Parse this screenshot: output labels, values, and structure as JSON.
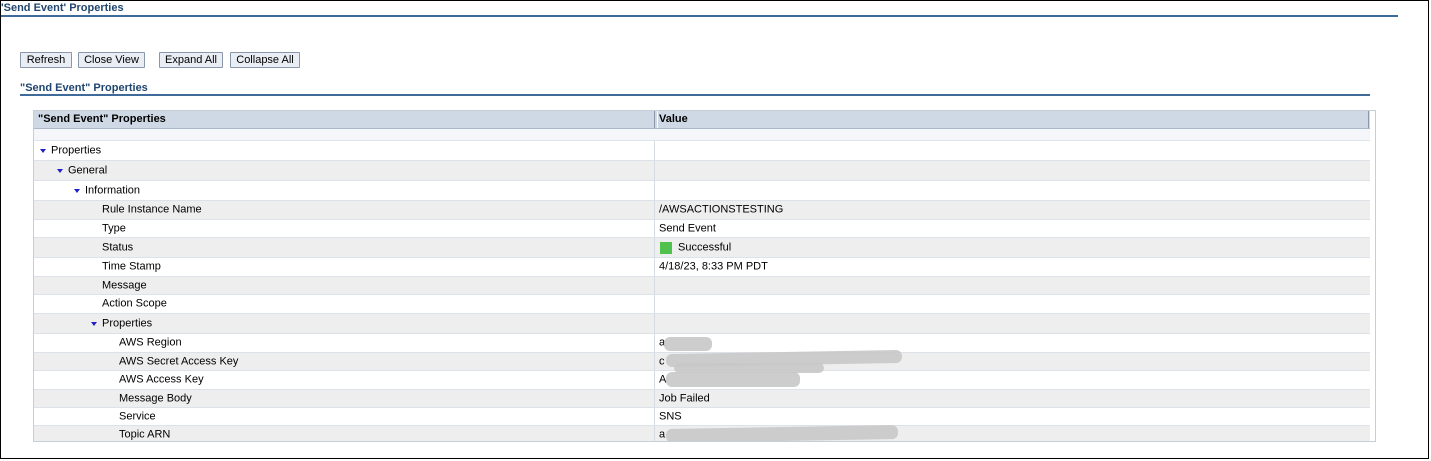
{
  "header": {
    "title": "'Send Event' Properties"
  },
  "toolbar": {
    "refresh_label": "Refresh",
    "close_view_label": "Close View",
    "expand_all_label": "Expand All",
    "collapse_all_label": "Collapse All"
  },
  "section": {
    "title": "\"Send Event\" Properties"
  },
  "table": {
    "columns": [
      "\"Send Event\" Properties",
      "Value"
    ],
    "rows": [
      {
        "label": "Properties",
        "value": ""
      },
      {
        "label": "General",
        "value": ""
      },
      {
        "label": "Information",
        "value": ""
      },
      {
        "label": "Rule Instance Name",
        "value": "/AWSACTIONSTESTING"
      },
      {
        "label": "Type",
        "value": "Send Event"
      },
      {
        "label": "Status",
        "value": "Successful"
      },
      {
        "label": "Time Stamp",
        "value": "4/18/23, 8:33 PM PDT"
      },
      {
        "label": "Message",
        "value": ""
      },
      {
        "label": "Action Scope",
        "value": ""
      },
      {
        "label": "Properties",
        "value": ""
      },
      {
        "label": "AWS Region",
        "value": "a"
      },
      {
        "label": "AWS Secret Access Key",
        "value": "c"
      },
      {
        "label": "AWS Access Key",
        "value": "A"
      },
      {
        "label": "Message Body",
        "value": "Job Failed"
      },
      {
        "label": "Service",
        "value": "SNS"
      },
      {
        "label": "Topic ARN",
        "value": "a"
      }
    ]
  },
  "colors": {
    "title_blue": "#20456e",
    "header_bg": "#cfd9e6",
    "status_green": "#4ec14e",
    "expand_arrow": "#2020c8"
  }
}
